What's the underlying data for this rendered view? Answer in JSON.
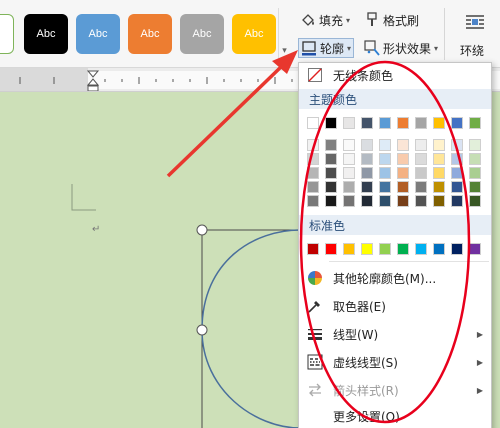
{
  "ribbon": {
    "style_swatches": [
      {
        "label": "Abc",
        "color": "#000000"
      },
      {
        "label": "Abc",
        "color": "#5b9bd5"
      },
      {
        "label": "Abc",
        "color": "#ed7d31"
      },
      {
        "label": "Abc",
        "color": "#a5a5a5"
      },
      {
        "label": "Abc",
        "color": "#ffc000"
      }
    ],
    "fill_label": "填充",
    "format_painter_label": "格式刷",
    "outline_label": "轮廓",
    "shape_effects_label": "形状效果",
    "wrap_label": "环绕"
  },
  "menu": {
    "no_outline_label": "无线条颜色",
    "theme_colors_header": "主题颜色",
    "standard_colors_header": "标准色",
    "theme_colors": [
      "#ffffff",
      "#000000",
      "#e7e6e6",
      "#44546a",
      "#5b9bd5",
      "#ed7d31",
      "#a5a5a5",
      "#ffc000",
      "#4472c4",
      "#70ad47"
    ],
    "standard_colors": [
      "#c00000",
      "#ff0000",
      "#ffc000",
      "#ffff00",
      "#92d050",
      "#00b050",
      "#00b0f0",
      "#0070c0",
      "#002060",
      "#7030a0"
    ],
    "more_colors_label": "其他轮廓颜色(M)...",
    "eyedropper_label": "取色器(E)",
    "line_weight_label": "线型(W)",
    "dash_type_label": "虚线线型(S)",
    "arrow_style_label": "箭头样式(R)",
    "more_settings_label": "更多设置(O)"
  },
  "document": {
    "paragraph_mark": "↵"
  },
  "annotation": {
    "arrow_color": "#e8372e",
    "ellipse_color": "#e8001c"
  }
}
